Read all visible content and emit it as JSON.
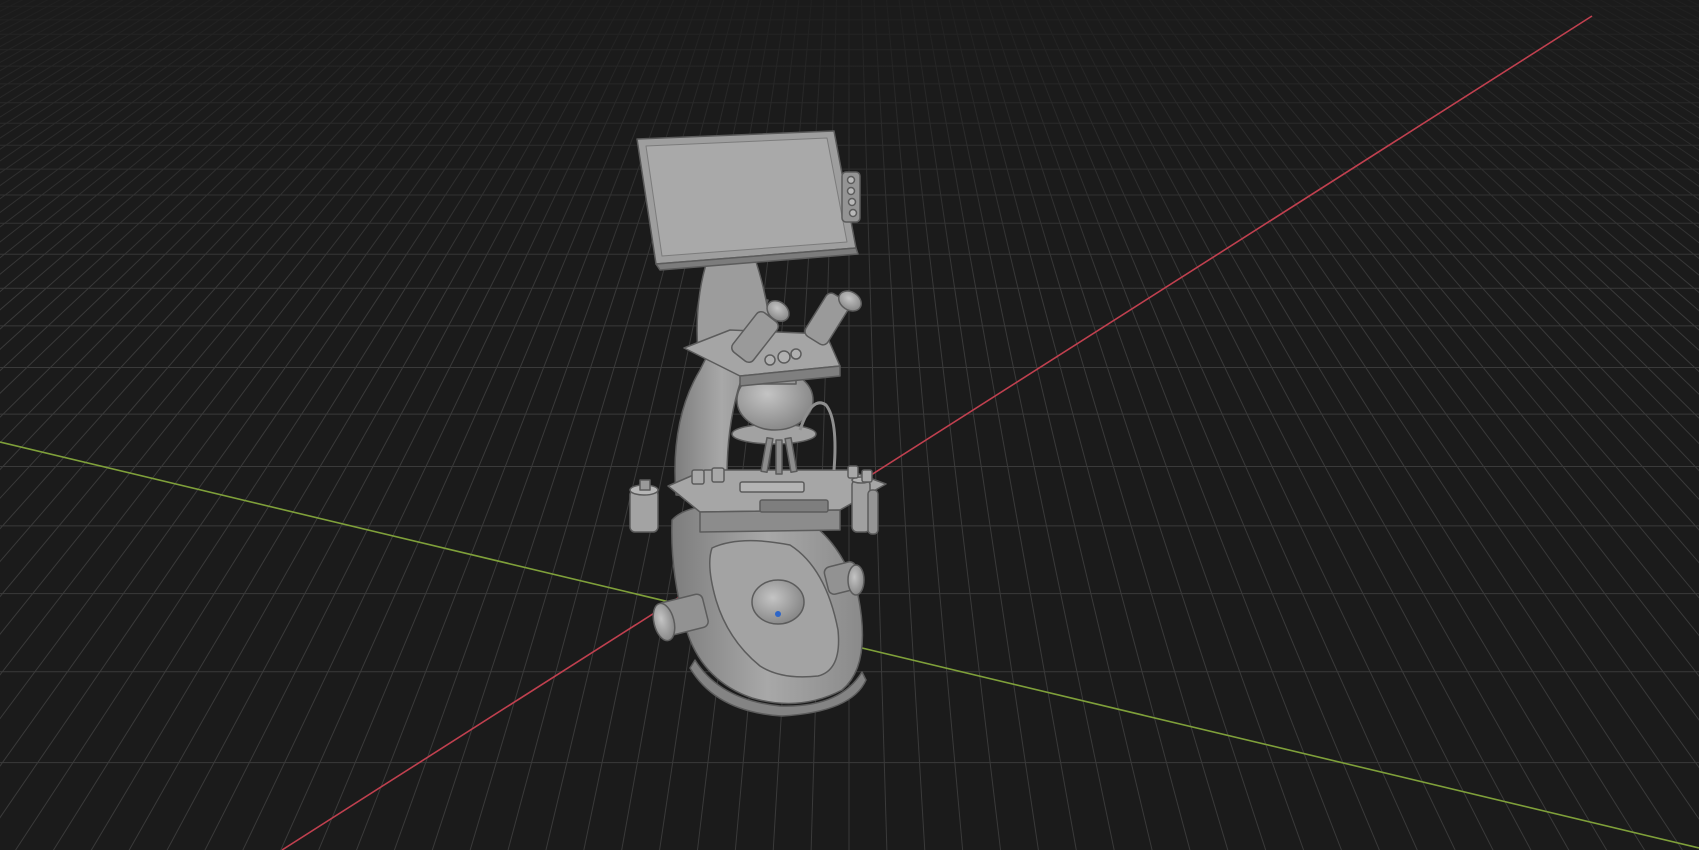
{
  "viewport": {
    "background": "#1b1b1b",
    "grid": "on",
    "grid_color": "#3a3a3a",
    "axis_x_color": "#c0404f",
    "axis_y_color": "#7fa03a"
  },
  "model": {
    "name": "microscope",
    "color": "#9a9a9a",
    "indicator_color": "#2e66c8"
  }
}
